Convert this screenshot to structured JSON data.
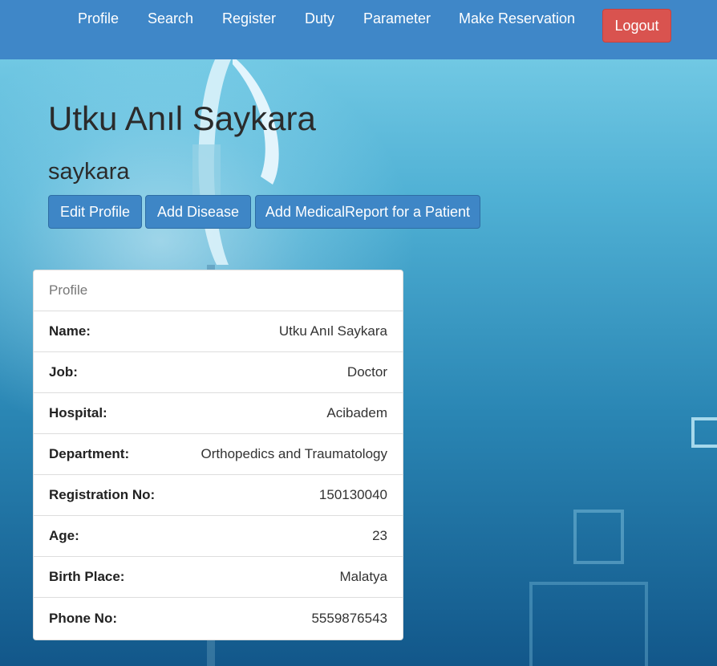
{
  "nav": {
    "items": [
      {
        "label": "Profile"
      },
      {
        "label": "Search"
      },
      {
        "label": "Register"
      },
      {
        "label": "Duty"
      },
      {
        "label": "Parameter"
      },
      {
        "label": "Make Reservation"
      }
    ],
    "logout_label": "Logout"
  },
  "user": {
    "full_name": "Utku Anıl Saykara",
    "username": "saykara"
  },
  "actions": {
    "edit_profile": "Edit Profile",
    "add_disease": "Add Disease",
    "add_report": "Add MedicalReport for a Patient"
  },
  "profile_panel": {
    "heading": "Profile",
    "rows": [
      {
        "label": "Name:",
        "value": "Utku Anıl Saykara"
      },
      {
        "label": "Job:",
        "value": "Doctor"
      },
      {
        "label": "Hospital:",
        "value": "Acibadem"
      },
      {
        "label": "Department:",
        "value": "Orthopedics and Traumatology"
      },
      {
        "label": "Registration No:",
        "value": "150130040"
      },
      {
        "label": "Age:",
        "value": "23"
      },
      {
        "label": "Birth Place:",
        "value": "Malatya"
      },
      {
        "label": "Phone No:",
        "value": "5559876543"
      }
    ]
  },
  "colors": {
    "navbar": "#3f87c8",
    "primary_button": "#3e86c6",
    "logout_button": "#d9534f"
  }
}
